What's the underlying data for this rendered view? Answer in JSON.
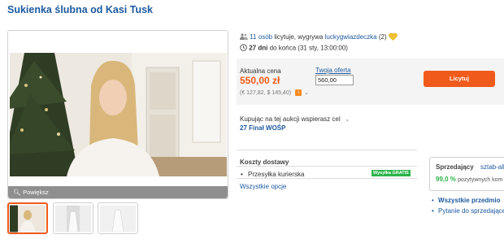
{
  "page": {
    "title": "Sukienka ślubna od Kasi Tusk"
  },
  "gallery": {
    "magnify_label": "Powiększ",
    "thumbnails": [
      "thumb-1",
      "thumb-2",
      "thumb-3"
    ]
  },
  "auction": {
    "bidders_count": "11 osób",
    "bidding_text": "licytuje, wygrywa",
    "winner": "luckygwiazdeczka",
    "winner_rating": "(2)",
    "days_left": "27 dni",
    "ends_text": "do końca (31 sty, 13:00:00)"
  },
  "price": {
    "current_label": "Aktualna cena",
    "current_value": "550,00 zł",
    "converted": "(€ 127,82, $ 145,40)",
    "offer_label": "Twoja oferta",
    "offer_value": "560,00",
    "bid_button": "Licytuj"
  },
  "charity": {
    "label": "Kupując na tej aukcji wspierasz cel",
    "name": "27 Finał WOŚP"
  },
  "shipping": {
    "title": "Koszty dostawy",
    "method": "Przesyłka kurierska",
    "badge": "Wysyłka GRATIS",
    "all_options": "Wszystkie opcje"
  },
  "seller": {
    "label": "Sprzedający",
    "name": "sztab-all",
    "positive_pct": "99,0 %",
    "positive_text": "pozytywnych kom",
    "all_items": "Wszystkie przedmio",
    "ask_seller": "Pytanie do sprzedające"
  },
  "colors": {
    "accent": "#f05a1a",
    "link": "#1e5aa0",
    "free_badge": "#2cb34a"
  }
}
